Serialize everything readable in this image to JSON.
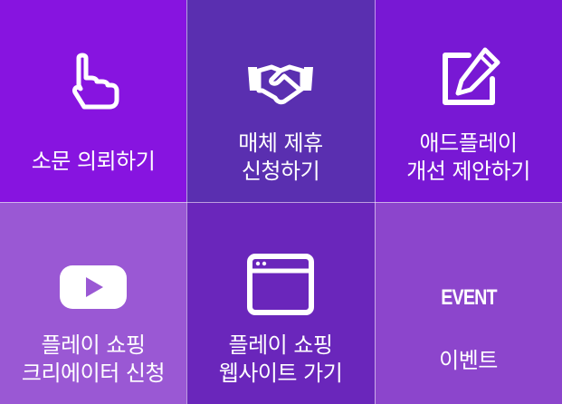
{
  "tiles": [
    {
      "id": "rumor-request",
      "label": "소문 의뢰하기",
      "icon": "pointing-hand-icon",
      "bg": "#8714e0"
    },
    {
      "id": "media-partnership",
      "label": "매체 제휴\n신청하기",
      "icon": "handshake-icon",
      "bg": "#5a2fb0"
    },
    {
      "id": "adplay-improvement",
      "label": "애드플레이\n개선 제안하기",
      "icon": "edit-icon",
      "bg": "#7818d4"
    },
    {
      "id": "youtube-creator",
      "label": "플레이 쇼핑\n크리에이터 신청",
      "icon": "youtube-play-icon",
      "bg": "#9a58d4"
    },
    {
      "id": "shopping-website",
      "label": "플레이 쇼핑\n웹사이트 가기",
      "icon": "browser-window-icon",
      "bg": "#6a26bb"
    },
    {
      "id": "event",
      "label": "이벤트",
      "icon": "event-text-icon",
      "icon_text": "EVENT",
      "bg": "#8c45cc"
    }
  ]
}
